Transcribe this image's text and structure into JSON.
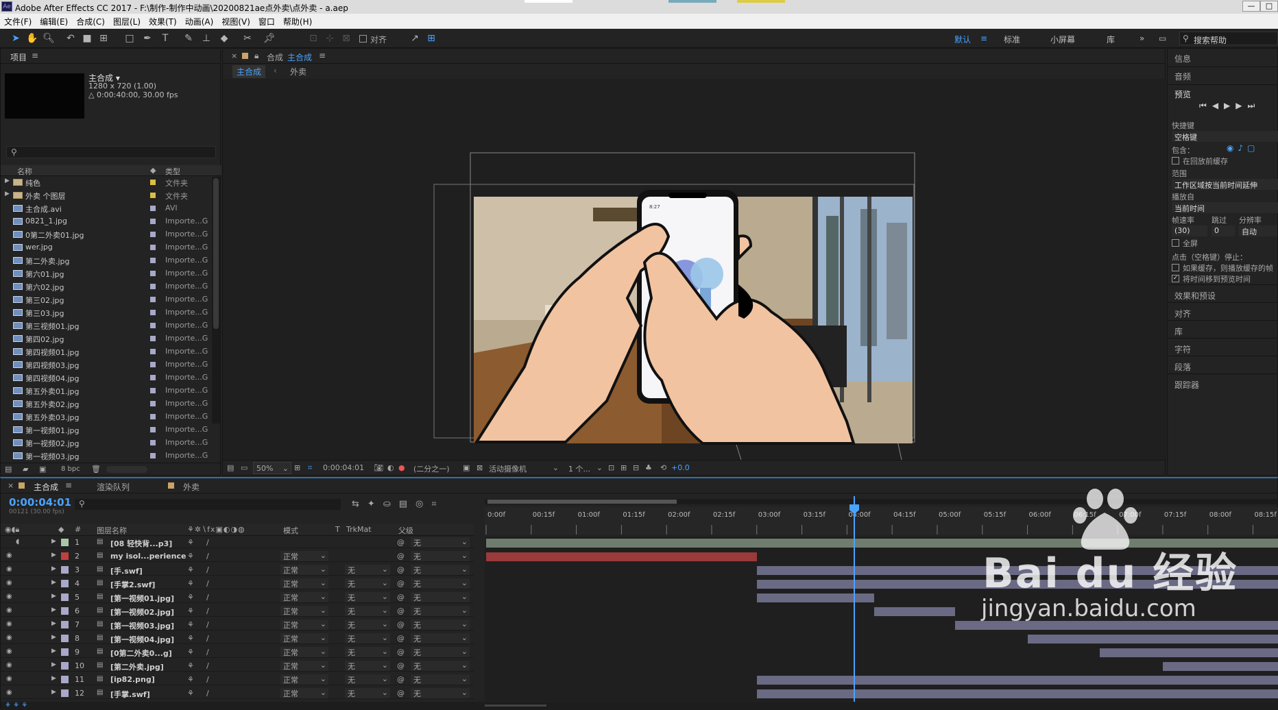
{
  "title": "Adobe After Effects CC 2017 - F:\\制作-制作中动画\\20200821ae点外卖\\点外卖 - a.aep",
  "menu": [
    "文件(F)",
    "编辑(E)",
    "合成(C)",
    "图层(L)",
    "效果(T)",
    "动画(A)",
    "视图(V)",
    "窗口",
    "帮助(H)"
  ],
  "toolbar": {
    "align_label": "对齐",
    "workspaces": [
      "默认",
      "标准",
      "小屏幕",
      "库"
    ],
    "search_help": "搜索帮助"
  },
  "project": {
    "tab": "项目",
    "comp_name": "主合成 ▾",
    "comp_size": "1280 x 720 (1.00)",
    "comp_dur": "△ 0:00:40:00, 30.00 fps",
    "col_name": "名称",
    "col_type": "类型",
    "bpc": "8 bpc",
    "items": [
      {
        "name": "纯色",
        "type": "文件夹",
        "folder": true
      },
      {
        "name": "外卖 个图层",
        "type": "文件夹",
        "folder": true
      },
      {
        "name": "主合成.avi",
        "type": "AVI",
        "folder": false
      },
      {
        "name": "0821_1.jpg",
        "type": "Importe...G",
        "folder": false
      },
      {
        "name": "0第二外卖01.jpg",
        "type": "Importe...G",
        "folder": false
      },
      {
        "name": "wer.jpg",
        "type": "Importe...G",
        "folder": false
      },
      {
        "name": "第二外卖.jpg",
        "type": "Importe...G",
        "folder": false
      },
      {
        "name": "第六01.jpg",
        "type": "Importe...G",
        "folder": false
      },
      {
        "name": "第六02.jpg",
        "type": "Importe...G",
        "folder": false
      },
      {
        "name": "第三02.jpg",
        "type": "Importe...G",
        "folder": false
      },
      {
        "name": "第三03.jpg",
        "type": "Importe...G",
        "folder": false
      },
      {
        "name": "第三视频01.jpg",
        "type": "Importe...G",
        "folder": false
      },
      {
        "name": "第四02.jpg",
        "type": "Importe...G",
        "folder": false
      },
      {
        "name": "第四视频01.jpg",
        "type": "Importe...G",
        "folder": false
      },
      {
        "name": "第四视频03.jpg",
        "type": "Importe...G",
        "folder": false
      },
      {
        "name": "第四视频04.jpg",
        "type": "Importe...G",
        "folder": false
      },
      {
        "name": "第五外卖01.jpg",
        "type": "Importe...G",
        "folder": false
      },
      {
        "name": "第五外卖02.jpg",
        "type": "Importe...G",
        "folder": false
      },
      {
        "name": "第五外卖03.jpg",
        "type": "Importe...G",
        "folder": false
      },
      {
        "name": "第一视频01.jpg",
        "type": "Importe...G",
        "folder": false
      },
      {
        "name": "第一视频02.jpg",
        "type": "Importe...G",
        "folder": false
      },
      {
        "name": "第一视频03.jpg",
        "type": "Importe...G",
        "folder": false
      }
    ]
  },
  "viewer": {
    "tab_label": "合成",
    "comp_tab": "主合成",
    "crumb1": "主合成",
    "crumb2": "外卖",
    "zoom": "50%",
    "time": "0:00:04:01",
    "res": "(二分之一)",
    "camera": "活动摄像机",
    "views": "1 个...",
    "exposure": "+0.0",
    "phone_time": "8:27"
  },
  "timeline": {
    "tab_comp": "主合成",
    "tab_render": "渲染队列",
    "tab_other": "外卖",
    "time": "0:00:04:01",
    "frames": "00121 (30.00 fps)",
    "col_name": "图层名称",
    "col_mode": "模式",
    "col_t": "T",
    "col_trk": "TrkMat",
    "col_parent": "父级",
    "ruler": [
      "0:00f",
      "00:15f",
      "01:00f",
      "01:15f",
      "02:00f",
      "02:15f",
      "03:00f",
      "03:15f",
      "04:00f",
      "04:15f",
      "05:00f",
      "05:15f",
      "06:00f",
      "06:15f",
      "07:00f",
      "07:15f",
      "08:00f",
      "08:15f"
    ],
    "layers": [
      {
        "num": "1",
        "name": "[08 轻快背...p3]",
        "mode": "",
        "trk": "",
        "parent": "无",
        "color": "#a8c8a8"
      },
      {
        "num": "2",
        "name": "my isol...perience",
        "mode": "正常",
        "trk": "",
        "parent": "无",
        "color": "#c04040"
      },
      {
        "num": "3",
        "name": "[手.swf]",
        "mode": "正常",
        "trk": "无",
        "parent": "无",
        "color": "#a8a8c8"
      },
      {
        "num": "4",
        "name": "[手掌2.swf]",
        "mode": "正常",
        "trk": "无",
        "parent": "无",
        "color": "#a8a8c8"
      },
      {
        "num": "5",
        "name": "[第一视频01.jpg]",
        "mode": "正常",
        "trk": "无",
        "parent": "无",
        "color": "#a8a8c8"
      },
      {
        "num": "6",
        "name": "[第一视频02.jpg]",
        "mode": "正常",
        "trk": "无",
        "parent": "无",
        "color": "#a8a8c8"
      },
      {
        "num": "7",
        "name": "[第一视频03.jpg]",
        "mode": "正常",
        "trk": "无",
        "parent": "无",
        "color": "#a8a8c8"
      },
      {
        "num": "8",
        "name": "[第一视频04.jpg]",
        "mode": "正常",
        "trk": "无",
        "parent": "无",
        "color": "#a8a8c8"
      },
      {
        "num": "9",
        "name": "[0第二外卖0...g]",
        "mode": "正常",
        "trk": "无",
        "parent": "无",
        "color": "#a8a8c8"
      },
      {
        "num": "10",
        "name": "[第二外卖.jpg]",
        "mode": "正常",
        "trk": "无",
        "parent": "无",
        "color": "#a8a8c8"
      },
      {
        "num": "11",
        "name": "[ip82.png]",
        "mode": "正常",
        "trk": "无",
        "parent": "无",
        "color": "#a8a8c8"
      },
      {
        "num": "12",
        "name": "[手掌.swf]",
        "mode": "正常",
        "trk": "无",
        "parent": "无",
        "color": "#a8a8c8"
      }
    ]
  },
  "right": {
    "info": "信息",
    "audio": "音频",
    "preview": "预览",
    "shortcut_label": "快捷键",
    "shortcut": "空格键",
    "include": "包含：",
    "cache_before": "在回放前缓存",
    "range_label": "范围",
    "range": "工作区域按当前时间延伸",
    "play_from_label": "播放自",
    "play_from": "当前时间",
    "fps_label": "帧速率",
    "skip_label": "跳过",
    "res_label": "分辨率",
    "fps": "(30)",
    "skip": "0",
    "res": "自动",
    "fullscreen": "全屏",
    "stop_label": "点击（空格键）停止：",
    "opt1": "如果缓存，则播放缓存的帧",
    "opt2": "将时间移到预览时间",
    "effects": "效果和预设",
    "align": "对齐",
    "library": "库",
    "character": "字符",
    "paragraph": "段落",
    "tracker": "跟踪器"
  },
  "watermark": {
    "brand": "Bai du 经验",
    "url": "jingyan.baidu.com"
  }
}
